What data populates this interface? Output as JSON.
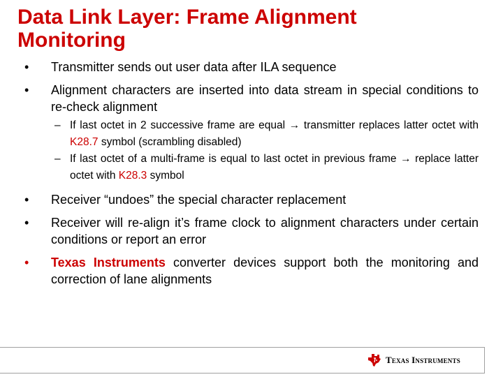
{
  "slide": {
    "title": "Data Link Layer: Frame Alignment Monitoring",
    "bullets": [
      {
        "text": "Transmitter sends out user data after ILA sequence"
      },
      {
        "text": "Alignment characters are inserted into data stream in special conditions to re-check alignment",
        "subbullets": [
          {
            "before": "If last octet in 2 successive frame are equal ",
            "arrow": "→",
            "middle": " transmitter replaces latter octet with ",
            "highlight": "K28.7",
            "after": " symbol (scrambling disabled)"
          },
          {
            "before": "If last octet of a multi-frame is equal to last octet in previous frame ",
            "arrow": "→",
            "middle": " replace latter octet with ",
            "highlight": "K28.3",
            "after": " symbol"
          }
        ]
      },
      {
        "text": "Receiver “undoes” the special character replacement"
      },
      {
        "text": "Receiver will re-align it’s frame clock to alignment characters under certain conditions or report an error"
      },
      {
        "highlight": "Texas Instruments",
        "text": " converter devices support both the monitoring and correction of lane alignments"
      }
    ],
    "bullet_glyph": "•",
    "dash_glyph": "–"
  },
  "footer": {
    "logo_text": "Texas Instruments",
    "logo_icon": "ti-state-logo-icon"
  },
  "colors": {
    "accent": "#cc0000",
    "text": "#000000",
    "rule": "#a0a0a0"
  }
}
